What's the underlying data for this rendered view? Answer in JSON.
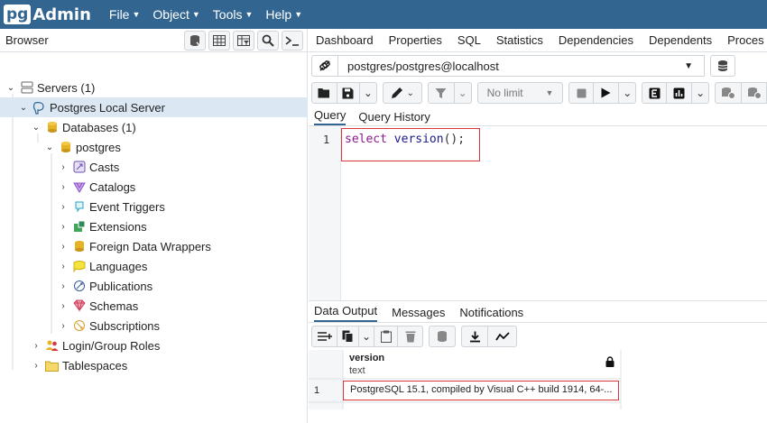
{
  "app": {
    "logo_pg": "pg",
    "logo_admin": "Admin"
  },
  "menu": [
    {
      "label": "File"
    },
    {
      "label": "Object"
    },
    {
      "label": "Tools"
    },
    {
      "label": "Help"
    }
  ],
  "browser": {
    "title": "Browser",
    "tree": [
      {
        "label": "Servers (1)",
        "level": 0,
        "chev": "⌄",
        "icon": "servers-icon"
      },
      {
        "label": "Postgres Local Server",
        "level": 1,
        "chev": "⌄",
        "icon": "server-icon",
        "selected": true
      },
      {
        "label": "Databases (1)",
        "level": 2,
        "chev": "⌄",
        "icon": "databases-icon"
      },
      {
        "label": "postgres",
        "level": 3,
        "chev": "⌄",
        "icon": "database-icon"
      },
      {
        "label": "Casts",
        "level": 4,
        "chev": "›",
        "icon": "casts-icon"
      },
      {
        "label": "Catalogs",
        "level": 4,
        "chev": "›",
        "icon": "catalogs-icon"
      },
      {
        "label": "Event Triggers",
        "level": 4,
        "chev": "›",
        "icon": "event-triggers-icon"
      },
      {
        "label": "Extensions",
        "level": 4,
        "chev": "›",
        "icon": "extensions-icon"
      },
      {
        "label": "Foreign Data Wrappers",
        "level": 4,
        "chev": "›",
        "icon": "fdw-icon"
      },
      {
        "label": "Languages",
        "level": 4,
        "chev": "›",
        "icon": "languages-icon"
      },
      {
        "label": "Publications",
        "level": 4,
        "chev": "›",
        "icon": "publications-icon"
      },
      {
        "label": "Schemas",
        "level": 4,
        "chev": "›",
        "icon": "schemas-icon"
      },
      {
        "label": "Subscriptions",
        "level": 4,
        "chev": "›",
        "icon": "subscriptions-icon"
      },
      {
        "label": "Login/Group Roles",
        "level": 2,
        "chev": "›",
        "icon": "roles-icon"
      },
      {
        "label": "Tablespaces",
        "level": 2,
        "chev": "›",
        "icon": "tablespaces-icon"
      }
    ]
  },
  "tabs": [
    {
      "label": "Dashboard"
    },
    {
      "label": "Properties"
    },
    {
      "label": "SQL"
    },
    {
      "label": "Statistics"
    },
    {
      "label": "Dependencies"
    },
    {
      "label": "Dependents"
    },
    {
      "label": "Proces"
    }
  ],
  "connection": {
    "value": "postgres/postgres@localhost"
  },
  "toolbar": {
    "limit_label": "No limit"
  },
  "query_tabs": [
    {
      "label": "Query"
    },
    {
      "label": "Query History"
    }
  ],
  "editor": {
    "line_number": "1",
    "keyword": "select",
    "function": "version",
    "punct": "();"
  },
  "data_tabs": [
    {
      "label": "Data Output"
    },
    {
      "label": "Messages"
    },
    {
      "label": "Notifications"
    }
  ],
  "result": {
    "column_name": "version",
    "column_type": "text",
    "row_number": "1",
    "cell": "PostgreSQL 15.1, compiled by Visual C++ build 1914, 64-..."
  },
  "colors": {
    "topbar": "#326690",
    "highlight": "#d9363e",
    "selected": "#dbe8f4"
  }
}
